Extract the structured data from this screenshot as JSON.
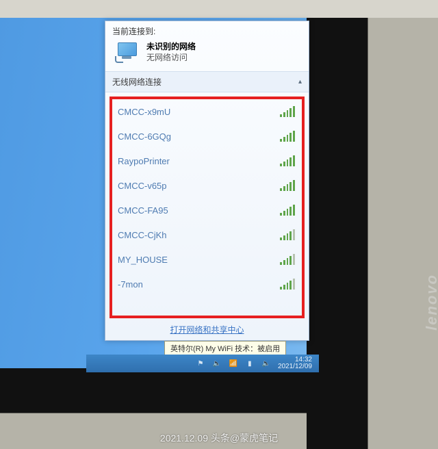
{
  "header": {
    "connected_to_label": "当前连接到:",
    "connection_name": "未识别的网络",
    "connection_status": "无网络访问"
  },
  "section": {
    "wireless_label": "无线网络连接"
  },
  "networks": [
    {
      "ssid": "CMCC-x9mU",
      "signal": 5
    },
    {
      "ssid": "CMCC-6GQg",
      "signal": 5
    },
    {
      "ssid": "RaypoPrinter",
      "signal": 5
    },
    {
      "ssid": "CMCC-v65p",
      "signal": 5
    },
    {
      "ssid": "CMCC-FA95",
      "signal": 5
    },
    {
      "ssid": "CMCC-CjKh",
      "signal": 4
    },
    {
      "ssid": "MY_HOUSE",
      "signal": 4
    },
    {
      "ssid": "-7mon",
      "signal": 4
    }
  ],
  "footer_link": "打开网络和共享中心",
  "tooltip": "英特尔(R) My WiFi 技术：被启用",
  "taskbar": {
    "time": "14:32",
    "date": "2021/12/09"
  },
  "brand": "lenovo",
  "watermark": "2021.12.09   头条@蒙虎笔记"
}
